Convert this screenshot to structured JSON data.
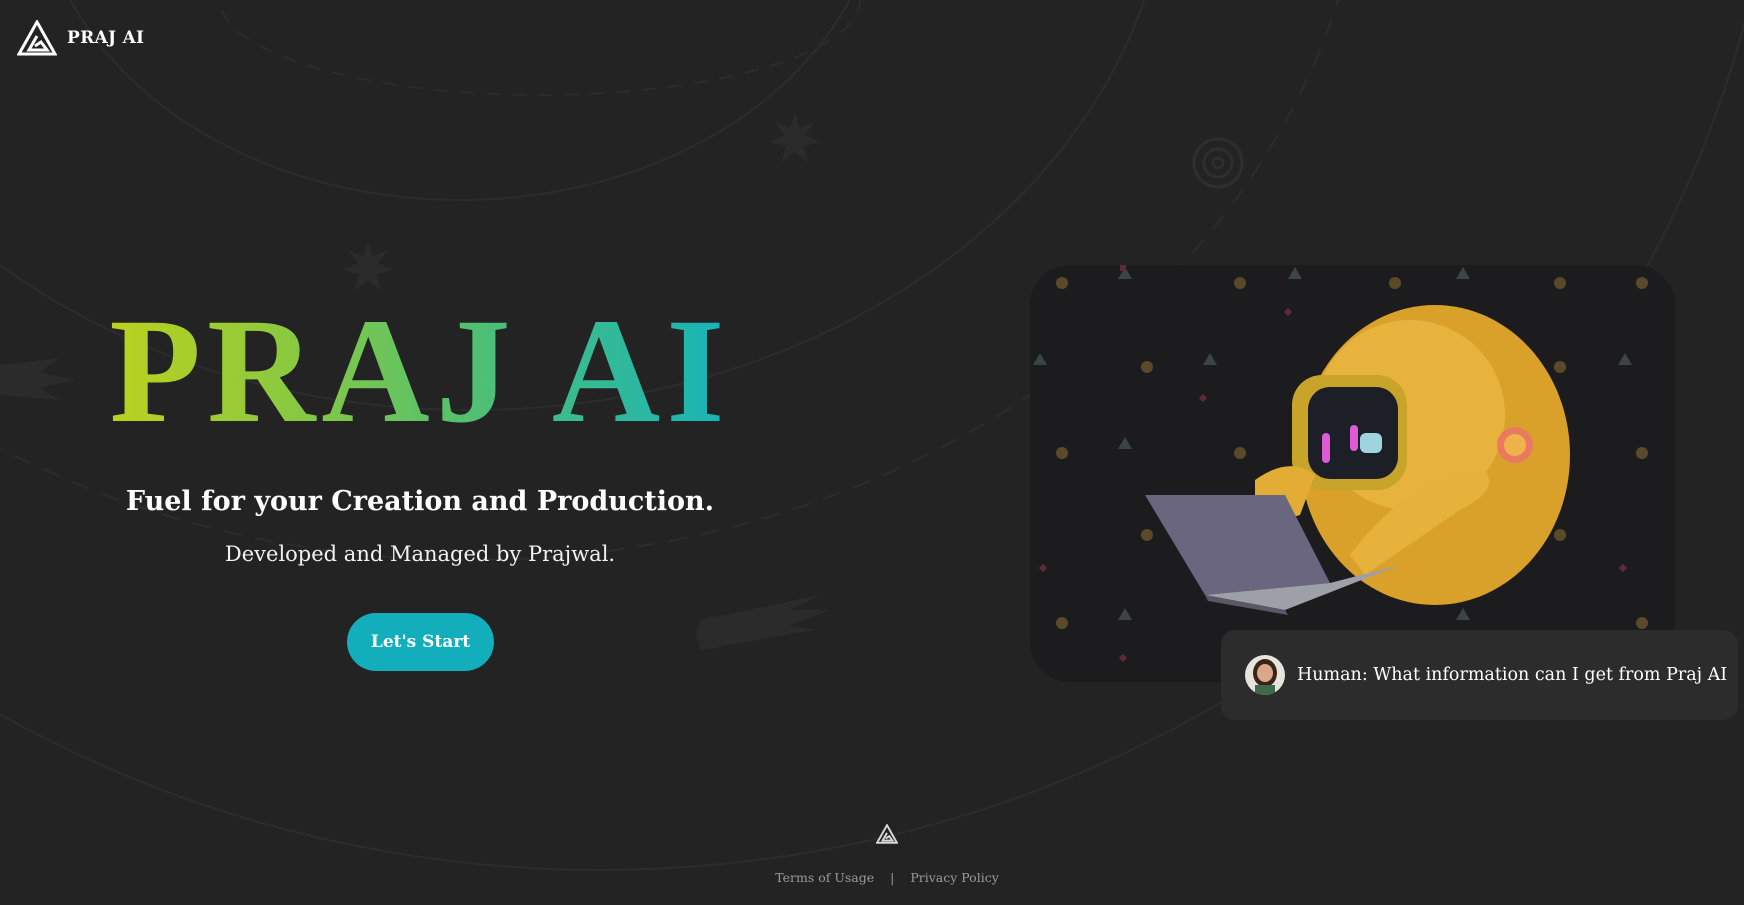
{
  "brand": {
    "name": "PRAJ AI",
    "logo_icon": "triangle-logo-icon"
  },
  "hero": {
    "title": "PRAJ AI",
    "tagline": "Fuel for your Creation and Production.",
    "subline": "Developed and Managed by Prajwal.",
    "cta_label": "Let's Start"
  },
  "chat": {
    "message": "Human: What information can I get from Praj AI",
    "avatar_icon": "user-avatar"
  },
  "footer": {
    "terms_label": "Terms of Usage",
    "separator": "|",
    "privacy_label": "Privacy Policy"
  },
  "colors": {
    "background": "#232323",
    "accent": "#12aebc",
    "gradient_start": "#c2d21a",
    "gradient_end": "#12b3c0"
  }
}
